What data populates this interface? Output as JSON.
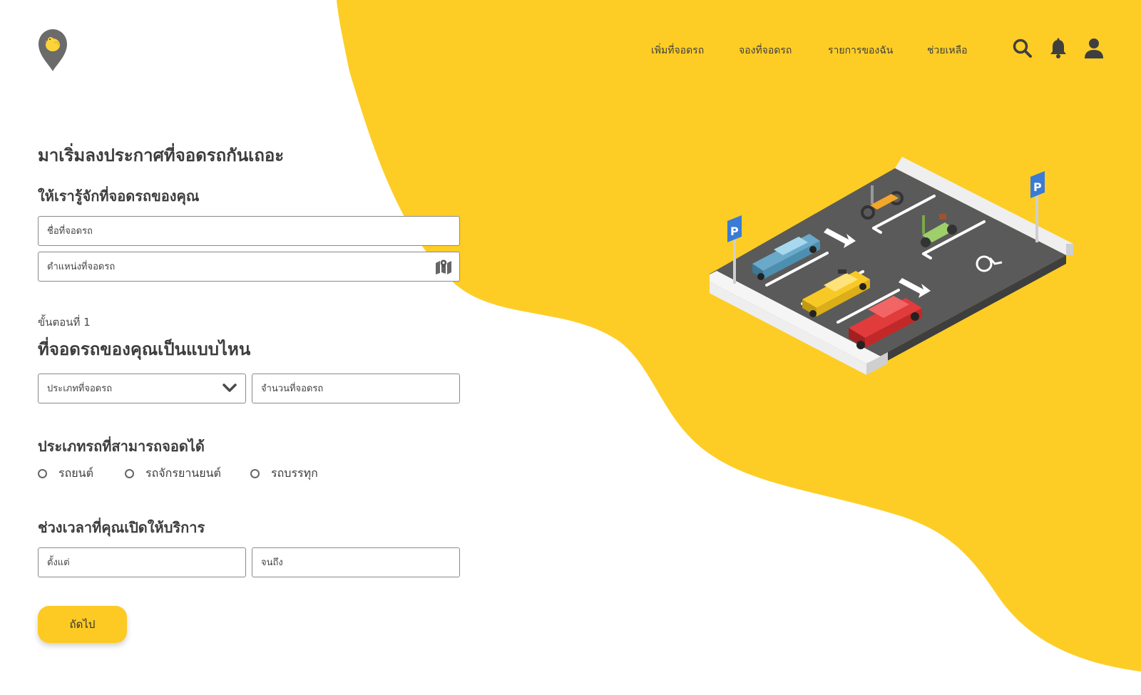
{
  "colors": {
    "accent": "#fdc923",
    "text": "#3d3d3d",
    "asphalt": "#5a5a5a",
    "curb": "#e6e6e6"
  },
  "logo": {
    "icon": "map-pin-chick-icon"
  },
  "nav": {
    "links": [
      "เพิ่มที่จอดรถ",
      "จองที่จอดรถ",
      "รายการของฉัน",
      "ช่วยเหลือ"
    ],
    "icons": [
      "search-icon",
      "bell-icon",
      "user-icon"
    ]
  },
  "form": {
    "page_title": "มาเริ่มลงประกาศที่จอดรถกันเถอะ",
    "intro_title": "ให้เรารู้จักที่จอดรถของคุณ",
    "parking_name_placeholder": "ชื่อที่จอดรถ",
    "location_placeholder": "ตำแหน่งที่จอดรถ",
    "step_label": "ขั้นตอนที่ 1",
    "step_title": "ที่จอดรถของคุณเป็นแบบไหน",
    "parking_type_placeholder": "ประเภทที่จอดรถ",
    "spot_count_placeholder": "จำนวนที่จอดรถ",
    "vehicle_types_title": "ประเภทรถที่สามารถจอดได้",
    "vehicle_types": [
      "รถยนต์",
      "รถจักรยานยนต์",
      "รถบรรทุก"
    ],
    "hours_title": "ช่วงเวลาที่คุณเปิดให้บริการ",
    "from_placeholder": "ตั้งแต่",
    "to_placeholder": "จนถึง",
    "next_button": "ถัดไป"
  },
  "illustration": {
    "name": "isometric-parking-lot-illustration",
    "sign_letter": "P"
  }
}
